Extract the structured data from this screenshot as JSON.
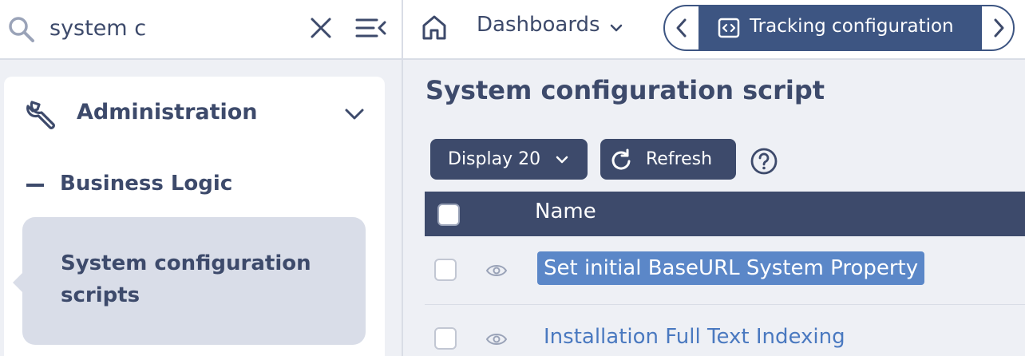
{
  "search": {
    "value": "system c"
  },
  "nav": {
    "section_label": "Administration",
    "group_label": "Business Logic",
    "active_item_label": "System configuration scripts"
  },
  "topbar": {
    "dashboards_label": "Dashboards",
    "active_tab_label": "Tracking configuration"
  },
  "page": {
    "title": "System configuration script",
    "display_label": "Display 20",
    "refresh_label": "Refresh"
  },
  "table": {
    "header_name": "Name",
    "rows": [
      {
        "name": "Set initial BaseURL System Property",
        "selected": true
      },
      {
        "name": "Installation Full Text Indexing",
        "selected": false
      }
    ]
  },
  "colors": {
    "primary": "#3d4a6b",
    "tab_active": "#3d5582",
    "highlight": "#5b87c8",
    "link": "#4a79c0",
    "panel_bg": "#eef0f5"
  },
  "icons": [
    "search-icon",
    "clear-icon",
    "collapse-menu-icon",
    "wrench-icon",
    "chevron-down-icon",
    "home-icon",
    "code-icon",
    "chevron-left-icon",
    "chevron-right-icon",
    "refresh-icon",
    "help-icon",
    "eye-icon"
  ]
}
